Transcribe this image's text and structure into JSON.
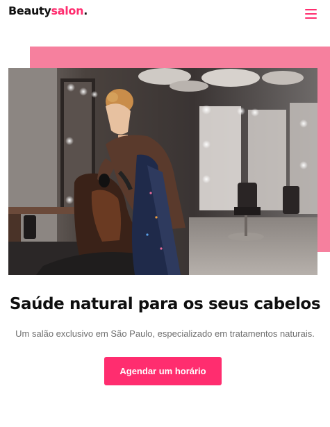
{
  "header": {
    "logo_part1": "Beauty",
    "logo_part2": "salon",
    "logo_part3": "."
  },
  "hero": {
    "title": "Saúde natural para os seus cabelos",
    "subtitle": "Um salão exclusivo em São Paulo, especializado em tratamentos naturais.",
    "cta_label": "Agendar um horário"
  },
  "colors": {
    "accent": "#ff2d6f",
    "pink_block": "#f6809e"
  },
  "icons": {
    "menu": "hamburger-menu-icon"
  }
}
